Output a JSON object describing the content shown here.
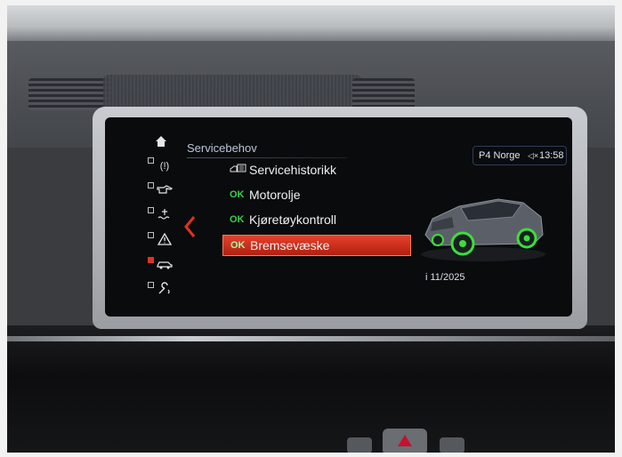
{
  "header": {
    "title": "Servicebehov"
  },
  "status": {
    "source": "P4 Norge",
    "speaker_icon": "speaker-icon",
    "time": "13:58"
  },
  "rail": [
    {
      "icon": "home-icon",
      "glyph": "⌂"
    },
    {
      "icon": "warning-bubble-icon",
      "glyph": "(!)"
    },
    {
      "icon": "oil-can-icon",
      "glyph": "⛽"
    },
    {
      "icon": "coolant-icon",
      "glyph": "≋"
    },
    {
      "icon": "warning-triangle-icon",
      "glyph": "⚠"
    },
    {
      "icon": "car-service-icon",
      "glyph": "🚗"
    },
    {
      "icon": "wrench-phone-icon",
      "glyph": "🔧"
    }
  ],
  "menu": [
    {
      "ok": "",
      "label": "Servicehistorikk",
      "icon": "service-booklet-icon"
    },
    {
      "ok": "OK",
      "label": "Motorolje"
    },
    {
      "ok": "OK",
      "label": "Kjøretøykontroll"
    },
    {
      "ok": "OK",
      "label": "Bremsevæske"
    }
  ],
  "detail": {
    "date": "i 11/2025"
  },
  "colors": {
    "accent": "#d32f1a",
    "ok_green": "#35d04a",
    "header_text": "#b9c7d8",
    "wheel_highlight": "#3adf3a"
  }
}
